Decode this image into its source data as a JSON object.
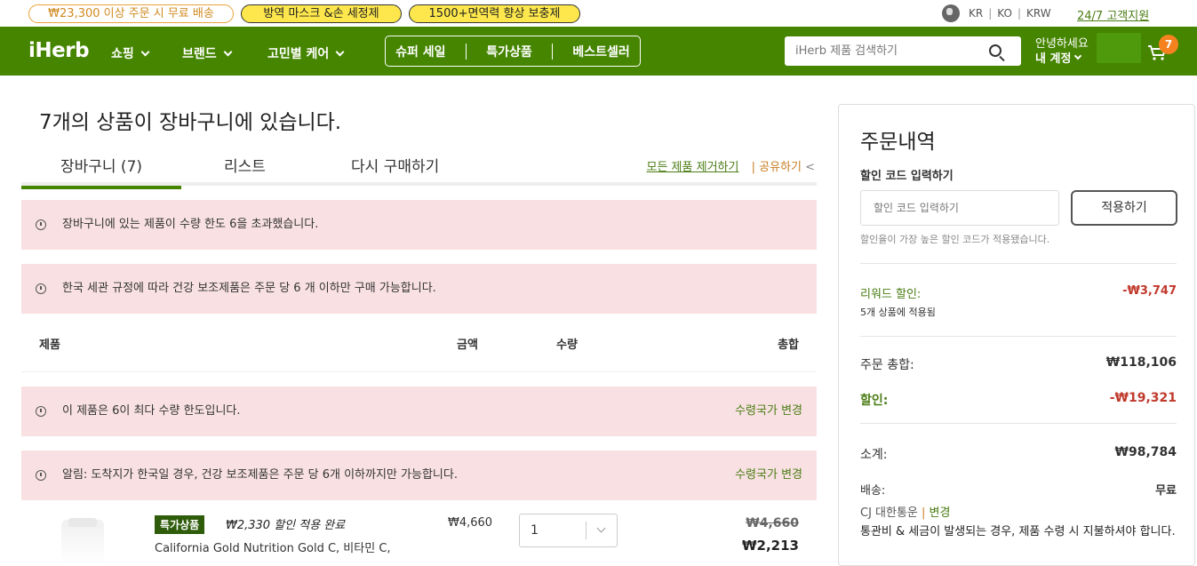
{
  "topbar": {
    "pills": [
      "₩23,300 이상 주문 시 무료 배송",
      "방역 마스크 &손 세정제",
      "1500+면역력 향상 보충제"
    ],
    "locale": [
      "KR",
      "KO",
      "KRW"
    ],
    "support": "24/7 고객지원"
  },
  "nav": {
    "logo": "iHerb",
    "menus": [
      "쇼핑",
      "브랜드",
      "고민별 케어"
    ],
    "promos": [
      "슈퍼 세일",
      "특가상품",
      "베스트셀러"
    ],
    "search_placeholder": "iHerb 제품 검색하기",
    "greeting": "안녕하세요",
    "account": "내 계정",
    "cart_count": "7"
  },
  "cart": {
    "title": "7개의 상품이 장바구니에 있습니다.",
    "tabs": [
      "장바구니 (7)",
      "리스트",
      "다시 구매하기"
    ],
    "remove_all": "모든 제품 제거하기",
    "share": "공유하기",
    "alerts": [
      "장바구니에 있는 제품이 수량 한도 6을 초과했습니다.",
      "한국 세관 규정에 따라 건강 보조제품은 주문 당 6 개 이하만 구매 가능합니다."
    ],
    "headers": {
      "product": "제품",
      "price": "금액",
      "qty": "수량",
      "total": "총합"
    },
    "item_alerts": [
      "이 제품은 6이 최다 수량 한도입니다.",
      "알림: 도착지가 한국일 경우, 건강 보조제품은 주문 당 6개 이하까지만 가능합니다."
    ],
    "change_country": "수령국가 변경",
    "item": {
      "tag": "특가상품",
      "discount": "₩2,330 할인 적용 완료",
      "name": "California Gold Nutrition Gold C, 비타민 C,",
      "price": "₩4,660",
      "qty": "1",
      "orig_total": "₩4,660",
      "total": "₩2,213"
    }
  },
  "summary": {
    "title": "주문내역",
    "coupon_label": "할인 코드 입력하기",
    "coupon_placeholder": "할인 코드 입력하기",
    "apply": "적용하기",
    "coupon_note": "할인율이 가장 높은 할인 코드가 적용됐습니다.",
    "rewards_label": "리워드 할인:",
    "rewards_sub": "5개 상품에 적용됨",
    "rewards_value": "-₩3,747",
    "order_total_label": "주문 총합:",
    "order_total": "₩118,106",
    "discount_label": "할인:",
    "discount": "-₩19,321",
    "subtotal_label": "소계:",
    "subtotal": "₩98,784",
    "shipping_label": "배송:",
    "shipping": "무료",
    "carrier": "CJ 대한통운",
    "change": "변경",
    "customs_note": "통관비 & 세금이 발생되는 경우, 제품 수령 시 지불하셔야 합니다."
  }
}
